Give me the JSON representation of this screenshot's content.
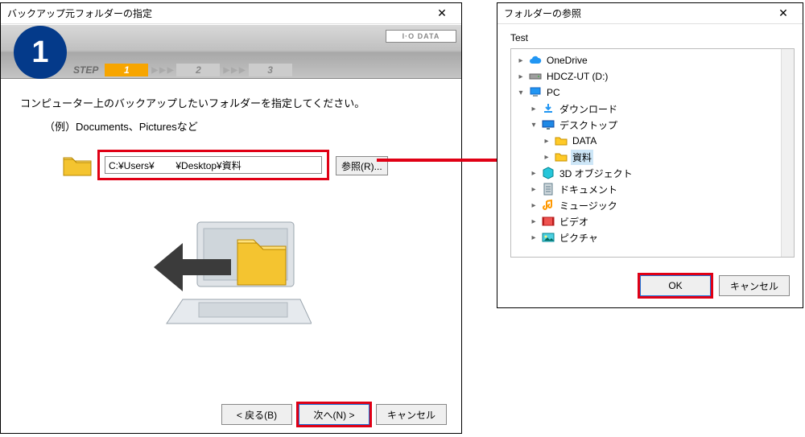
{
  "leftWindow": {
    "title": "バックアップ元フォルダーの指定",
    "brand": "I·O DATA",
    "step": {
      "label": "STEP",
      "items": [
        "1",
        "2",
        "3"
      ],
      "active": 0
    },
    "badgeNumber": "1",
    "instruction": "コンピューター上のバックアップしたいフォルダーを指定してください。",
    "example": "（例）Documents、Picturesなど",
    "pathValue": "C:¥Users¥        ¥Desktop¥資料",
    "browseLabel": "参照(R)...",
    "buttons": {
      "back": "< 戻る(B)",
      "next": "次へ(N) >",
      "cancel": "キャンセル"
    }
  },
  "rightWindow": {
    "title": "フォルダーの参照",
    "label": "Test",
    "tree": [
      {
        "depth": 0,
        "toggle": "closed",
        "icon": "cloud",
        "label": "OneDrive"
      },
      {
        "depth": 0,
        "toggle": "closed",
        "icon": "drive",
        "label": "HDCZ-UT (D:)"
      },
      {
        "depth": 0,
        "toggle": "open",
        "icon": "pc",
        "label": "PC"
      },
      {
        "depth": 1,
        "toggle": "closed",
        "icon": "download",
        "label": "ダウンロード"
      },
      {
        "depth": 1,
        "toggle": "open",
        "icon": "desktop",
        "label": "デスクトップ"
      },
      {
        "depth": 2,
        "toggle": "closed",
        "icon": "folder",
        "label": "DATA"
      },
      {
        "depth": 2,
        "toggle": "closed",
        "icon": "folder",
        "label": "資料",
        "selected": true
      },
      {
        "depth": 1,
        "toggle": "closed",
        "icon": "3d",
        "label": "3D オブジェクト"
      },
      {
        "depth": 1,
        "toggle": "closed",
        "icon": "doc",
        "label": "ドキュメント"
      },
      {
        "depth": 1,
        "toggle": "closed",
        "icon": "music",
        "label": "ミュージック"
      },
      {
        "depth": 1,
        "toggle": "closed",
        "icon": "video",
        "label": "ビデオ"
      },
      {
        "depth": 1,
        "toggle": "closed",
        "icon": "picture",
        "label": "ピクチャ"
      }
    ],
    "buttons": {
      "ok": "OK",
      "cancel": "キャンセル"
    }
  }
}
